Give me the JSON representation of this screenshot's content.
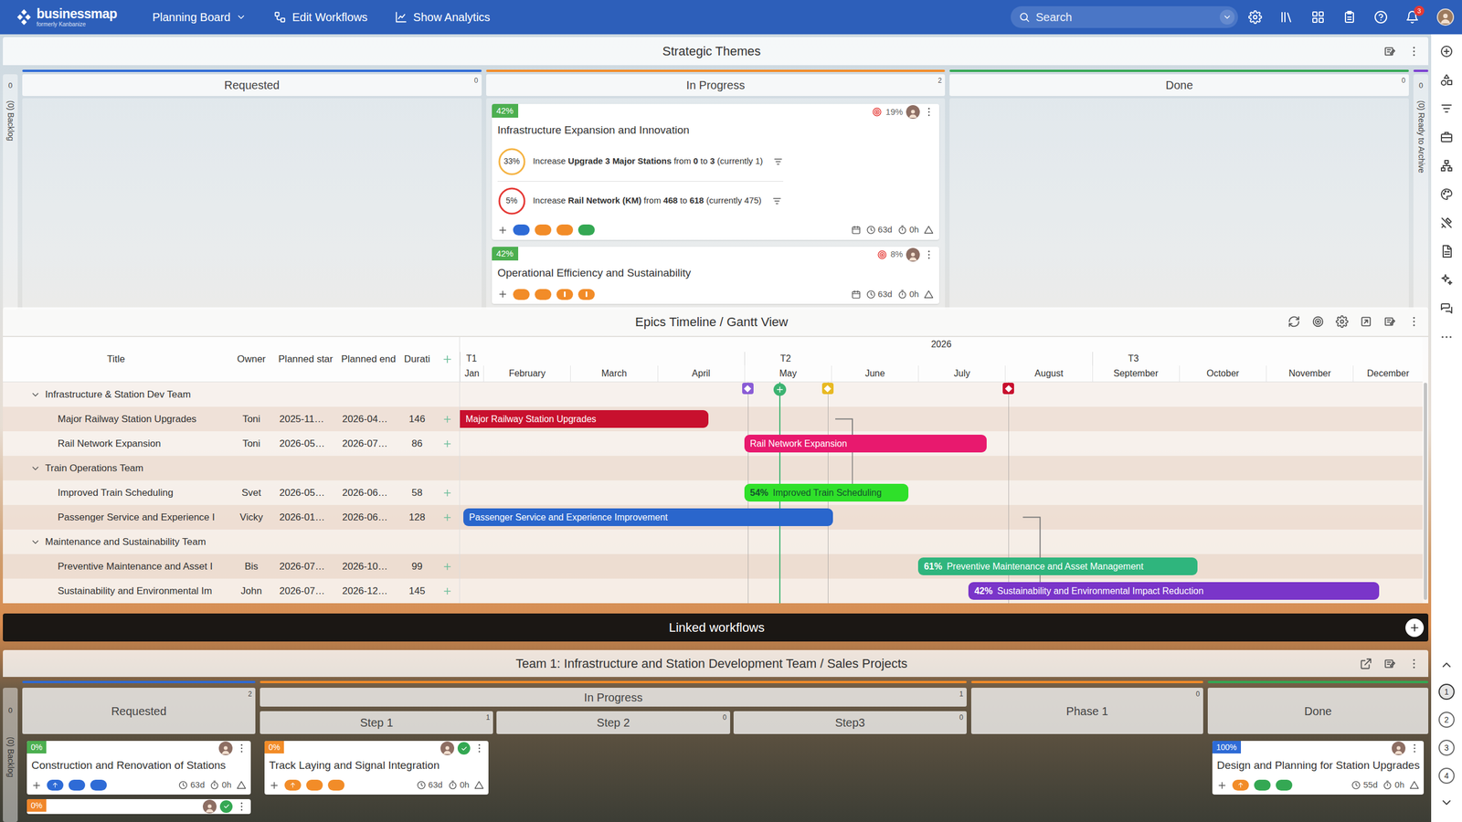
{
  "nav": {
    "logo": {
      "name": "businessmap",
      "subtitle": "formerly Kanbanize"
    },
    "menu": [
      {
        "label": "Planning Board",
        "dropdown": true
      },
      {
        "label": "Edit Workflows",
        "dropdown": false
      },
      {
        "label": "Show Analytics",
        "dropdown": false
      }
    ],
    "search": {
      "placeholder": "Search"
    },
    "notifications": "3"
  },
  "strategic_themes": {
    "title": "Strategic Themes",
    "backlog": {
      "count": "0",
      "label": "(0) Backlog"
    },
    "archive": {
      "count": "0",
      "label": "(0) Ready to Archive",
      "color": "#7b3fd1"
    },
    "columns": [
      {
        "name": "Requested",
        "count": "0",
        "color": "#2e6bd6",
        "cards": []
      },
      {
        "name": "In Progress",
        "count": "2",
        "color": "#f28c28",
        "cards": [
          {
            "progress": "42%",
            "color": "#4caf50",
            "target": "19%",
            "title": "Infrastructure Expansion and Innovation",
            "objectives": [
              {
                "percent": "33%",
                "color": "#f5b342",
                "segments": [
                  {
                    "text": "Increase ",
                    "bold": false
                  },
                  {
                    "text": "Upgrade 3 Major Stations",
                    "bold": true
                  },
                  {
                    "text": " from ",
                    "bold": false
                  },
                  {
                    "text": "0",
                    "bold": true
                  },
                  {
                    "text": " to ",
                    "bold": false
                  },
                  {
                    "text": "3",
                    "bold": true
                  },
                  {
                    "text": " (currently 1)",
                    "bold": false
                  }
                ]
              },
              {
                "percent": "5%",
                "color": "#e53935",
                "segments": [
                  {
                    "text": "Increase ",
                    "bold": false
                  },
                  {
                    "text": "Rail Network (KM)",
                    "bold": true
                  },
                  {
                    "text": " from ",
                    "bold": false
                  },
                  {
                    "text": "468",
                    "bold": true
                  },
                  {
                    "text": " to ",
                    "bold": false
                  },
                  {
                    "text": "618",
                    "bold": true
                  },
                  {
                    "text": " (currently 475)",
                    "bold": false
                  }
                ]
              }
            ],
            "tags": [
              {
                "color": "#2e6bd6",
                "kind": "plain"
              },
              {
                "color": "#f28c28",
                "kind": "plain"
              },
              {
                "color": "#f28c28",
                "kind": "plain"
              },
              {
                "color": "#34a853",
                "kind": "plain"
              }
            ],
            "duration": "63d",
            "time": "0h"
          },
          {
            "progress": "42%",
            "color": "#4caf50",
            "target": "8%",
            "title": "Operational Efficiency and Sustainability",
            "objectives": [],
            "tags": [
              {
                "color": "#f28c28",
                "kind": "plain"
              },
              {
                "color": "#f28c28",
                "kind": "plain"
              },
              {
                "color": "#f28c28",
                "kind": "mark"
              },
              {
                "color": "#f28c28",
                "kind": "mark"
              }
            ],
            "duration": "63d",
            "time": "0h"
          }
        ]
      },
      {
        "name": "Done",
        "count": "0",
        "color": "#34a853",
        "cards": []
      }
    ]
  },
  "gantt": {
    "title": "Epics Timeline / Gantt View",
    "columns": [
      "Title",
      "Owner",
      "Planned star",
      "Planned end",
      "Durati"
    ],
    "year": "2026",
    "quarters": [
      {
        "label": "T1",
        "start": 0,
        "end": 4
      },
      {
        "label": "T2",
        "start": 4,
        "end": 8
      },
      {
        "label": "T3",
        "start": 8,
        "end": 12
      }
    ],
    "months": [
      "Jan",
      "February",
      "March",
      "April",
      "May",
      "June",
      "July",
      "August",
      "September",
      "October",
      "November",
      "December"
    ],
    "axis": {
      "min": 0.73,
      "max": 11.8
    },
    "today": 4.4,
    "milestones": [
      {
        "at": 4.04,
        "color": "#8a5cd6"
      },
      {
        "at": 4.96,
        "color": "#e8b923"
      },
      {
        "at": 7.04,
        "color": "#c8102e"
      }
    ],
    "rows": [
      {
        "kind": "group",
        "title": "Infrastructure & Station Dev Team",
        "expanded": true
      },
      {
        "kind": "item",
        "title": "Major Railway Station Upgrades",
        "owner": "Toni",
        "start_text": "2025-11…",
        "end_text": "2026-04…",
        "duration": "146",
        "bar": {
          "label": "Major Railway Station Upgrades",
          "progress": "",
          "start": -1.5,
          "end": 3.59,
          "color": "#c8102e"
        }
      },
      {
        "kind": "item",
        "title": "Rail Network Expansion",
        "owner": "Toni",
        "start_text": "2026-05…",
        "end_text": "2026-07…",
        "duration": "86",
        "bar": {
          "label": "Rail Network Expansion",
          "progress": "",
          "start": 4.0,
          "end": 6.79,
          "color": "#e8196e"
        }
      },
      {
        "kind": "group",
        "title": "Train Operations Team",
        "expanded": true
      },
      {
        "kind": "item",
        "title": "Improved Train Scheduling",
        "owner": "Svet",
        "start_text": "2026-05…",
        "end_text": "2026-06…",
        "duration": "58",
        "bar": {
          "label": "Improved Train Scheduling",
          "progress": "54%",
          "start": 4.0,
          "end": 5.89,
          "color": "#2fe02a"
        }
      },
      {
        "kind": "item",
        "title": "Passenger Service and Experience I",
        "owner": "Vicky",
        "start_text": "2026-01…",
        "end_text": "2026-06…",
        "duration": "128",
        "bar": {
          "label": "Passenger Service and Experience Improvement",
          "progress": "",
          "start": 0.77,
          "end": 5.02,
          "color": "#2a66cc"
        }
      },
      {
        "kind": "group",
        "title": "Maintenance and Sustainability Team",
        "expanded": true
      },
      {
        "kind": "item",
        "title": "Preventive Maintenance and Asset I",
        "owner": "Bis",
        "start_text": "2026-07…",
        "end_text": "2026-10…",
        "duration": "99",
        "bar": {
          "label": "Preventive Maintenance and Asset Management",
          "progress": "61%",
          "start": 6.0,
          "end": 9.21,
          "color": "#2fb57d"
        }
      },
      {
        "kind": "item",
        "title": "Sustainability and Environmental Im",
        "owner": "John",
        "start_text": "2026-07…",
        "end_text": "2026-12…",
        "duration": "145",
        "bar": {
          "label": "Sustainability and Environmental Impact Reduction",
          "progress": "42%",
          "start": 6.58,
          "end": 11.3,
          "color": "#7a35c9"
        }
      }
    ],
    "links": [
      [
        1,
        2
      ],
      [
        1,
        4
      ],
      [
        5,
        7
      ],
      [
        5,
        8
      ]
    ]
  },
  "linked": {
    "title": "Linked workflows"
  },
  "team_board": {
    "title": "Team 1: Infrastructure and Station Development Team / Sales Projects",
    "backlog": {
      "count": "0",
      "label": "(0) Backlog"
    },
    "columns": [
      {
        "name": "Requested",
        "count": "2",
        "color": "#2e6bd6",
        "cards": [
          {
            "progress": "0%",
            "color": "#4caf50",
            "approved": false,
            "title": "Construction and Renovation of Stations",
            "tags": [
              {
                "color": "#2e6bd6",
                "kind": "arrow"
              },
              {
                "color": "#2e6bd6",
                "kind": "plain"
              },
              {
                "color": "#2e6bd6",
                "kind": "plain"
              }
            ],
            "duration": "63d",
            "time": "0h"
          },
          {
            "progress": "0%",
            "color": "#f0862a",
            "approved": true
          }
        ]
      },
      {
        "name": "In Progress",
        "count": "1",
        "color": "#f28c28",
        "subcolumns": [
          {
            "name": "Step 1",
            "count": "1",
            "cards": [
              {
                "progress": "0%",
                "color": "#f28c28",
                "approved": true,
                "title": "Track Laying and Signal Integration",
                "tags": [
                  {
                    "color": "#f28c28",
                    "kind": "arrow"
                  },
                  {
                    "color": "#f28c28",
                    "kind": "plain"
                  },
                  {
                    "color": "#f28c28",
                    "kind": "plain"
                  }
                ],
                "duration": "63d",
                "time": "0h"
              }
            ]
          },
          {
            "name": "Step 2",
            "count": "0",
            "cards": []
          },
          {
            "name": "Step3",
            "count": "0",
            "cards": []
          }
        ]
      },
      {
        "name": "Phase 1",
        "count": "0",
        "color": "#f28c28",
        "cards": []
      },
      {
        "name": "Done",
        "color": "#34a853",
        "cards": [
          {
            "progress": "100%",
            "color": "#2e6bd6",
            "approved": false,
            "title": "Design and Planning for Station Upgrades",
            "tags": [
              {
                "color": "#f28c28",
                "kind": "arrow"
              },
              {
                "color": "#34a853",
                "kind": "plain"
              },
              {
                "color": "#34a853",
                "kind": "plain"
              }
            ],
            "duration": "55d",
            "time": "0h"
          }
        ]
      }
    ]
  },
  "sidebar": {
    "pages": [
      {
        "label": "1",
        "selected": true
      },
      {
        "label": "2",
        "selected": false
      },
      {
        "label": "3",
        "selected": false
      },
      {
        "label": "4",
        "selected": false
      }
    ]
  }
}
